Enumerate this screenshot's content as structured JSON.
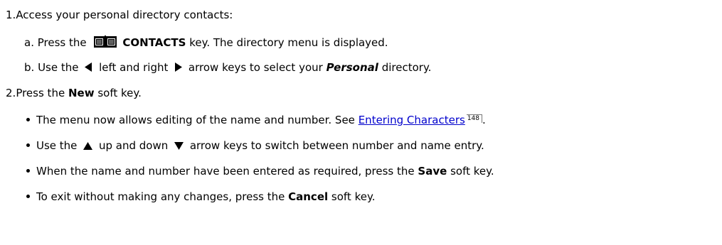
{
  "steps": [
    {
      "number": "1.",
      "text": "Access your personal directory contacts:",
      "substeps": [
        {
          "letter": "a.",
          "pre": "Press the",
          "key_label": "CONTACTS",
          "post": "key. The directory menu is displayed.",
          "icon": "book-icon"
        },
        {
          "letter": "b.",
          "pre": "Use the",
          "mid": "left and right",
          "post_pre": "arrow keys to select your",
          "emphasis": "Personal",
          "post": "directory.",
          "icons": [
            "left-arrow-icon",
            "right-arrow-icon"
          ]
        }
      ]
    },
    {
      "number": "2.",
      "pre": "Press the",
      "key": "New",
      "post": "soft key.",
      "bullets": [
        {
          "pre": "The menu now allows editing of the name and number. See",
          "link": "Entering Characters",
          "ref": "148",
          "post": "."
        },
        {
          "pre": "Use the",
          "mid": "up and down",
          "post": "arrow keys to switch between number and name entry.",
          "icons": [
            "up-arrow-icon",
            "down-arrow-icon"
          ]
        },
        {
          "pre": "When the name and number have been entered as required, press the",
          "key": "Save",
          "post": "soft key."
        },
        {
          "pre": "To exit without making any changes, press the",
          "key": "Cancel",
          "post": "soft key."
        }
      ]
    }
  ]
}
